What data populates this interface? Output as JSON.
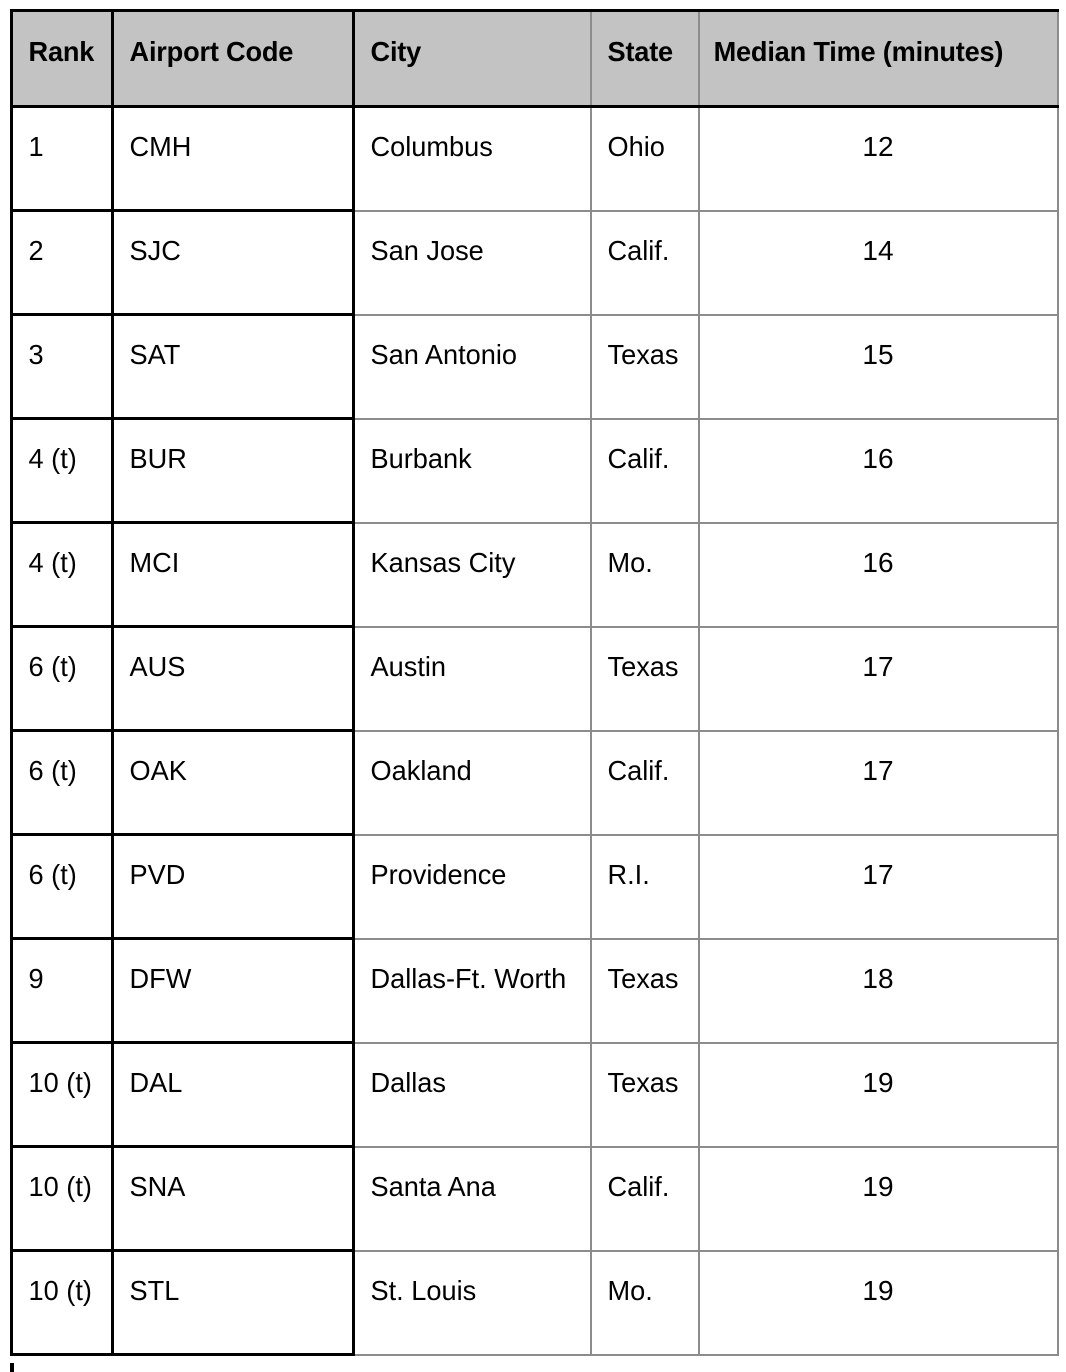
{
  "table": {
    "name": "airport-median-time-ranking",
    "columns": [
      {
        "key": "rank",
        "label": "Rank"
      },
      {
        "key": "code",
        "label": "Airport Code"
      },
      {
        "key": "city",
        "label": "City"
      },
      {
        "key": "state",
        "label": "State"
      },
      {
        "key": "time",
        "label": "Median Time (minutes)"
      }
    ],
    "rows": [
      {
        "rank": "1",
        "code": "CMH",
        "city": "Columbus",
        "state": "Ohio",
        "time": "12"
      },
      {
        "rank": "2",
        "code": "SJC",
        "city": "San Jose",
        "state": "Calif.",
        "time": "14"
      },
      {
        "rank": "3",
        "code": "SAT",
        "city": "San Antonio",
        "state": "Texas",
        "time": "15"
      },
      {
        "rank": "4 (t)",
        "code": "BUR",
        "city": "Burbank",
        "state": "Calif.",
        "time": "16"
      },
      {
        "rank": "4 (t)",
        "code": "MCI",
        "city": "Kansas City",
        "state": "Mo.",
        "time": "16"
      },
      {
        "rank": "6 (t)",
        "code": "AUS",
        "city": "Austin",
        "state": "Texas",
        "time": "17"
      },
      {
        "rank": "6 (t)",
        "code": "OAK",
        "city": "Oakland",
        "state": "Calif.",
        "time": "17"
      },
      {
        "rank": "6 (t)",
        "code": "PVD",
        "city": "Providence",
        "state": "R.I.",
        "time": "17"
      },
      {
        "rank": "9",
        "code": "DFW",
        "city": "Dallas-Ft. Worth",
        "state": "Texas",
        "time": "18"
      },
      {
        "rank": "10 (t)",
        "code": "DAL",
        "city": "Dallas",
        "state": "Texas",
        "time": "19"
      },
      {
        "rank": "10 (t)",
        "code": "SNA",
        "city": "Santa Ana",
        "state": "Calif.",
        "time": "19"
      },
      {
        "rank": "10 (t)",
        "code": "STL",
        "city": "St. Louis",
        "state": "Mo.",
        "time": "19"
      }
    ]
  },
  "chart_data": {
    "type": "table",
    "title": "Median Time (minutes)",
    "columns": [
      "Rank",
      "Airport Code",
      "City",
      "State",
      "Median Time (minutes)"
    ],
    "categories": [
      "CMH",
      "SJC",
      "SAT",
      "BUR",
      "MCI",
      "AUS",
      "OAK",
      "PVD",
      "DFW",
      "DAL",
      "SNA",
      "STL"
    ],
    "values": [
      12,
      14,
      15,
      16,
      16,
      17,
      17,
      17,
      18,
      19,
      19,
      19
    ],
    "ylabel": "Median Time (minutes)",
    "xlabel": "Airport Code"
  },
  "colors": {
    "header_background": "#c3c3c3",
    "body_background": "#ffffff",
    "text": "#000000",
    "border_dark": "#000000",
    "border_light": "#8c8c8c"
  }
}
